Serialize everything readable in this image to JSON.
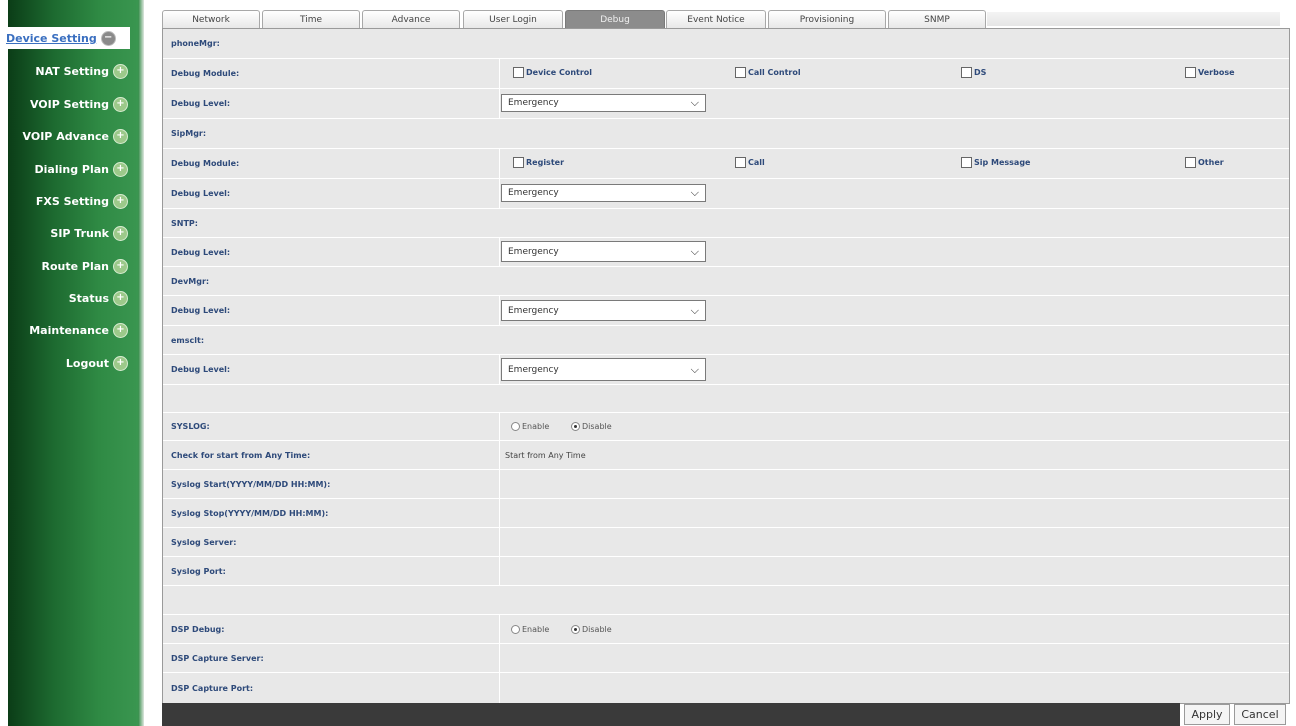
{
  "sidebar": {
    "items": [
      {
        "label": "Device Setting",
        "icon": "minus-circle-icon"
      },
      {
        "label": "NAT Setting",
        "icon": "plus-circle-icon"
      },
      {
        "label": "VOIP Setting",
        "icon": "plus-circle-icon"
      },
      {
        "label": "VOIP Advance",
        "icon": "plus-circle-icon"
      },
      {
        "label": "Dialing Plan",
        "icon": "plus-circle-icon"
      },
      {
        "label": "FXS Setting",
        "icon": "plus-circle-icon"
      },
      {
        "label": "SIP Trunk",
        "icon": "plus-circle-icon"
      },
      {
        "label": "Route Plan",
        "icon": "plus-circle-icon"
      },
      {
        "label": "Status",
        "icon": "plus-circle-icon"
      },
      {
        "label": "Maintenance",
        "icon": "plus-circle-icon"
      },
      {
        "label": "Logout",
        "icon": "plus-circle-icon"
      }
    ],
    "icon_minus": "−",
    "icon_plus": "+"
  },
  "tabs": [
    "Network",
    "Time",
    "Advance",
    "User Login",
    "Debug",
    "Event Notice",
    "Provisioning",
    "SNMP"
  ],
  "active_tab": "Debug",
  "chevron": "⌵",
  "phoneMgr": {
    "title": "phoneMgr:",
    "module_label": "Debug Module:",
    "modules": [
      "Device Control",
      "Call Control",
      "DS",
      "Verbose"
    ],
    "level_label": "Debug Level:",
    "level_value": "Emergency"
  },
  "sipMgr": {
    "title": "SipMgr:",
    "module_label": "Debug Module:",
    "modules": [
      "Register",
      "Call",
      "Sip Message",
      "Other"
    ],
    "level_label": "Debug Level:",
    "level_value": "Emergency"
  },
  "sntp": {
    "title": "SNTP:",
    "level_label": "Debug Level:",
    "level_value": "Emergency"
  },
  "devMgr": {
    "title": "DevMgr:",
    "level_label": "Debug Level:",
    "level_value": "Emergency"
  },
  "emsclt": {
    "title": "emsclt:",
    "level_label": "Debug Level:",
    "level_value": "Emergency"
  },
  "syslog": {
    "label": "SYSLOG:",
    "enable": "Enable",
    "disable": "Disable",
    "selected": "Disable",
    "check_label": "Check for start from Any Time:",
    "check_value": "Start from Any Time",
    "start_label": "Syslog Start(YYYY/MM/DD HH:MM):",
    "stop_label": "Syslog Stop(YYYY/MM/DD HH:MM):",
    "server_label": "Syslog Server:",
    "port_label": "Syslog Port:"
  },
  "dsp": {
    "label": "DSP Debug:",
    "enable": "Enable",
    "disable": "Disable",
    "selected": "Disable",
    "server_label": "DSP Capture Server:",
    "port_label": "DSP Capture Port:"
  },
  "actions": {
    "apply": "Apply",
    "cancel": "Cancel"
  }
}
